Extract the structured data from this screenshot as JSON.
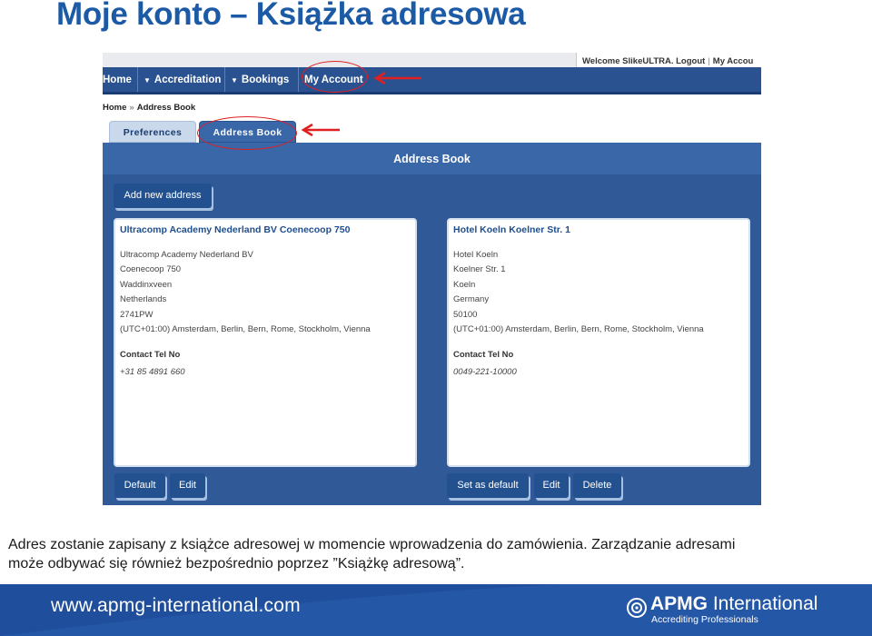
{
  "slide": {
    "title": "Moje konto – Książka adresowa"
  },
  "topbar": {
    "welcome": "Welcome SlikeULTRA.",
    "logout": "Logout",
    "my_account": "My Accou"
  },
  "nav": {
    "items": [
      {
        "label": "Home",
        "has_caret": false
      },
      {
        "label": "Accreditation",
        "has_caret": true
      },
      {
        "label": "Bookings",
        "has_caret": true
      },
      {
        "label": "My Account",
        "has_caret": false,
        "highlighted": true
      }
    ]
  },
  "breadcrumb": {
    "home": "Home",
    "current": "Address Book"
  },
  "tabs": [
    {
      "label": "Preferences",
      "active": false
    },
    {
      "label": "Address Book",
      "active": true,
      "highlighted": true
    }
  ],
  "panel": {
    "title": "Address Book",
    "add_button": "Add new address"
  },
  "addresses": [
    {
      "title": "Ultracomp Academy Nederland BV Coenecoop 750",
      "lines": [
        "Ultracomp Academy Nederland BV",
        "Coenecoop 750",
        "Waddinxveen",
        "Netherlands",
        "2741PW",
        "(UTC+01:00) Amsterdam, Berlin, Bern, Rome, Stockholm, Vienna"
      ],
      "contact_label": "Contact Tel No",
      "tel": "+31 85 4891 660",
      "buttons": [
        "Default",
        "Edit"
      ]
    },
    {
      "title": "Hotel Koeln Koelner Str. 1",
      "lines": [
        "Hotel Koeln",
        "Koelner Str. 1",
        "Koeln",
        "Germany",
        "50100",
        "(UTC+01:00) Amsterdam, Berlin, Bern, Rome, Stockholm, Vienna"
      ],
      "contact_label": "Contact Tel No",
      "tel": "0049-221-10000",
      "buttons": [
        "Set as default",
        "Edit",
        "Delete"
      ]
    }
  ],
  "caption": {
    "line1": "Adres zostanie zapisany z książce adresowej w momencie wprowadzenia do zamówienia. Zarządzanie adresami",
    "line2": "może odbywać się również bezpośrednio poprzez ”Książkę adresową”."
  },
  "footer": {
    "url": "www.apmg-international.com",
    "logo_bold": "APMG",
    "logo_rest": " International",
    "logo_tagline": "Accrediting Professionals"
  },
  "colors": {
    "brand_blue": "#1c5aa6",
    "nav": "#2b5290",
    "panel": "#2f5997",
    "highlight_red": "#e02020",
    "footer": "#1f4e9c"
  },
  "icons": [
    "caret-down-icon",
    "breadcrumb-chevron-icon",
    "red-arrow-icon",
    "apmg-logo-icon"
  ]
}
